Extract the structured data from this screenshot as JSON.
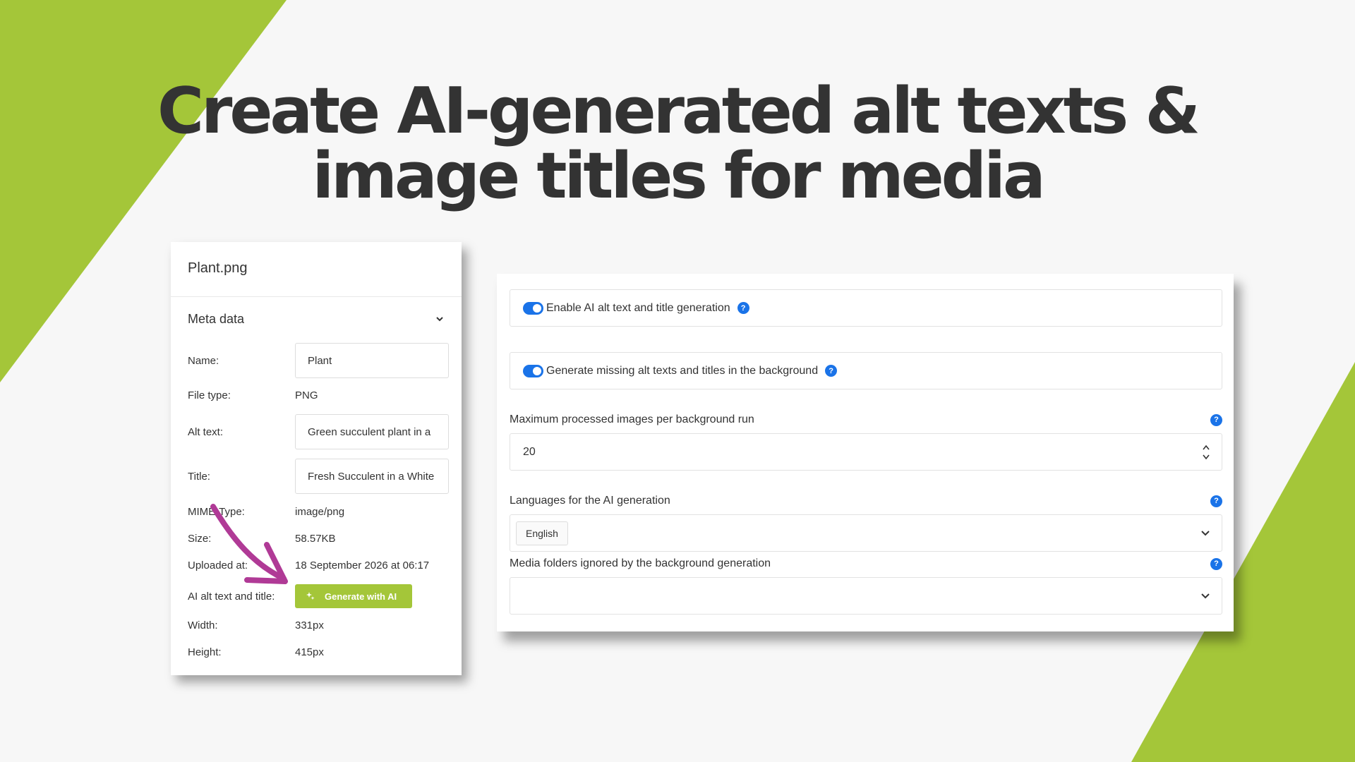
{
  "colors": {
    "accent_green": "#a4c639",
    "toggle_blue": "#1a73e8",
    "arrow_magenta": "#b03a96",
    "background": "#f7f7f7"
  },
  "headline": {
    "line1": "Create AI-generated alt texts &",
    "line2": "image titles for media"
  },
  "meta_panel": {
    "filename": "Plant.png",
    "section_title": "Meta data",
    "section_icon": "chevron-down-icon",
    "name_label": "Name:",
    "name_value": "Plant",
    "file_type_label": "File type:",
    "file_type_value": "PNG",
    "alt_text_label": "Alt text:",
    "alt_text_value": "Green succulent plant in a",
    "title_label": "Title:",
    "title_value": "Fresh Succulent in a White",
    "mime_label": "MIME-Type:",
    "mime_value": "image/png",
    "size_label": "Size:",
    "size_value": "58.57KB",
    "uploaded_label": "Uploaded at:",
    "uploaded_value": "18 September 2026 at 06:17",
    "ai_label": "AI alt text and title:",
    "ai_button_label": "Generate with AI",
    "ai_button_icon": "sparkle-icon",
    "width_label": "Width:",
    "width_value": "331px",
    "height_label": "Height:",
    "height_value": "415px"
  },
  "settings_panel": {
    "enable_ai_label": "Enable AI alt text and title generation",
    "enable_ai_on": true,
    "background_gen_label": "Generate missing alt texts and titles in the background",
    "background_gen_on": true,
    "max_images_label": "Maximum processed images per background run",
    "max_images_value": "20",
    "languages_label": "Languages for the AI generation",
    "languages_selected": "English",
    "ignored_folders_label": "Media folders ignored by the background generation",
    "help_glyph": "?"
  }
}
